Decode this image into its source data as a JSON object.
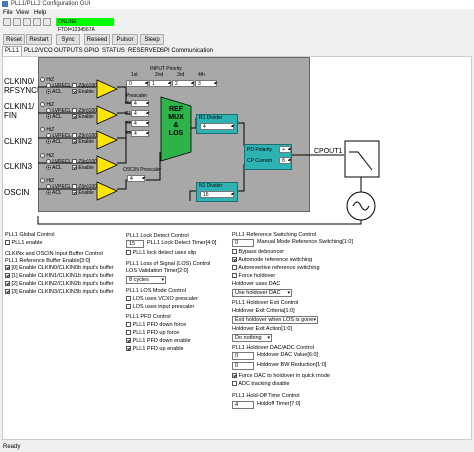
{
  "window": {
    "title": "PLL1/PLL2 Configuration GUI"
  },
  "menu": [
    "File",
    "View",
    "Help"
  ],
  "connection": {
    "status": "ONLINE FTDI=1234567A",
    "color": "#00ff00"
  },
  "toolbar": [
    "Reset",
    "Restart",
    "Sync",
    "Reseed",
    "Pulsor",
    "Sleep"
  ],
  "tabs": [
    "PLL1",
    "PLL2/VCO",
    "OUTPUTS",
    "GPIO",
    "STATUS",
    "RESERVED",
    "SPI Communication"
  ],
  "diagram": {
    "input_priority_label": "INPUT Priority",
    "priority_cols": [
      "1st",
      "2nd",
      "3rd",
      "4th"
    ],
    "priority_values": [
      "0",
      "1",
      "2",
      "3"
    ],
    "inputs": [
      {
        "name": "CLKIN0/\nRFSYNCIN",
        "opt1": "HiZ",
        "opt2": "LVPECL",
        "opt3": "ACL",
        "opt4": "Z(in)100",
        "opt5": "Enable"
      },
      {
        "name": "CLKIN1/\nFIN",
        "opt1": "HiZ",
        "opt2": "LVPECL",
        "opt3": "ACL",
        "opt4": "Z(in)100",
        "opt5": "Enable"
      },
      {
        "name": "CLKIN2",
        "opt1": "HiZ",
        "opt2": "LVPECL",
        "opt3": "ACL",
        "opt4": "Z(in)100",
        "opt5": "Enable"
      },
      {
        "name": "CLKIN3",
        "opt1": "HiZ",
        "opt2": "LVPECL",
        "opt3": "ACL",
        "opt4": "Z(in)100",
        "opt5": "Enable"
      },
      {
        "name": "OSCIN",
        "opt1": "HiZ",
        "opt2": "LVPECL",
        "opt3": "ACL",
        "opt4": "Z(in)100",
        "opt5": "Enable"
      }
    ],
    "prescaler_label": "Prescaler",
    "prescalers": [
      {
        "label": "R0",
        "value": "4"
      },
      {
        "label": "R1",
        "value": "4"
      },
      {
        "label": "R2",
        "value": "4"
      },
      {
        "label": "R3",
        "value": "4"
      }
    ],
    "osc_prescaler_label": "OSCIN Prescaler",
    "osc_prescaler_value": "4",
    "ref_mux_label": "REF\nMUX\n&\nLOS",
    "r1_divider_label": "R1 Divider",
    "r1_divider_value": "4",
    "n1_divider_label": "N1 Divider",
    "n1_divider_value": "16",
    "pd_polarity_label": "PD Polarity",
    "pd_polarity_value": "+",
    "cp_current_label": "CP Current",
    "cp_current_value": "8",
    "cpout_label": "CPOUT1"
  },
  "col1": {
    "global_title": "PLL1 Global Control",
    "pll1_enable": "PLL1 enable",
    "buffer_title": "CLKINx and OSCIN Input Buffer Control",
    "ref_buffer_label": "PLL1 Reference Buffer Enable[3:0]",
    "buffers": [
      "[0] Enable CLKIN0/CLKIN0b input's buffer",
      "[1] Enable CLKIN1/CLKIN1b input's buffer",
      "[2] Enable CLKIN2/CLKIN2b input's buffer",
      "[3] Enable CLKIN3/CLKIN3b input's buffer"
    ]
  },
  "col2": {
    "lock_title": "PLL1 Lock Detect Control",
    "lock_timer_value": "15",
    "lock_timer_label": "PLL1 Lock Detect Timer[4:0]",
    "lock_slip_label": "PLL1 lock detect uses slip",
    "los_title": "PLL1 Loss of Signal (LOS) Control",
    "los_timer_label": "LOS Validation Timer[2:0]",
    "los_timer_value": "8 cycles",
    "los_mode_title": "PLL1 LOS Mode Control",
    "los_vcxo": "LOS uses VCXO prescaler",
    "los_input": "LOS uses input prescaler",
    "pfd_title": "PLL1 PFD Control",
    "pfd_items": [
      "PLL1 PFD down force",
      "PLL1 PFD up force",
      "PLL1 PFD down enable",
      "PLL1 PFD up enable"
    ]
  },
  "col3": {
    "refsw_title": "PLL1 Reference Switching Control",
    "manual_ref_value": "0",
    "manual_ref_label": "Manual Mode Reference Switching[1:0]",
    "refsw_items": [
      "Bypass debouncer",
      "Automode reference switching",
      "Autorevertive reference switching",
      "Force holdover"
    ],
    "holdover_dac_label": "Holdover uses DAC",
    "holdover_dac_value": "Use holdover DAC",
    "holdover_exit_title": "PLL1 Holdover Exit Control",
    "holdover_exit_criteria_label": "Holdover Exit Criteria[1:0]",
    "holdover_exit_criteria_value": "Exit holdover when LOS is gone",
    "holdover_exit_action_label": "Holdover Exit Action[1:0]",
    "holdover_exit_action_value": "Do nothing",
    "dac_title": "PLL1 Holdover DAC/ADC Control",
    "dac_value_num": "0",
    "dac_value_label": "Holdover DAC Value[6:0]",
    "bw_num": "0",
    "bw_label": "Holdover BW Reduction[1:0]",
    "force_dac": "Force DAC to holdover in quick mode",
    "adc_tracking": "ADC tracking disable",
    "holdoff_title": "PLL1 Hold-Off Time Control",
    "holdoff_num": "4",
    "holdoff_label": "Holdoff Timer[7:0]"
  },
  "status": {
    "text": "Ready"
  }
}
